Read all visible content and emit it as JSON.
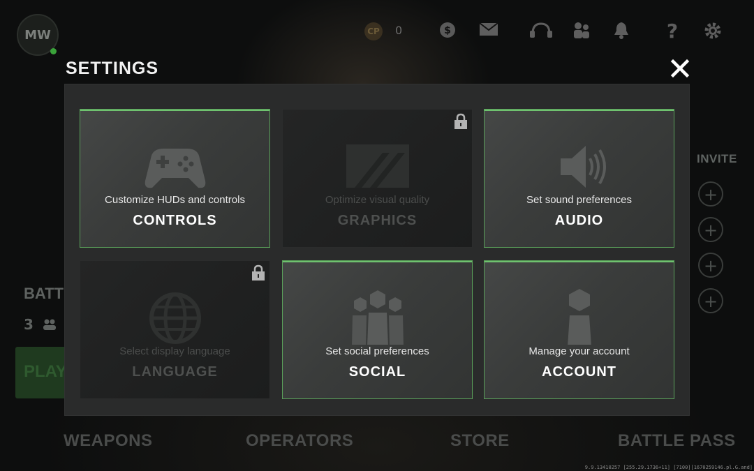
{
  "modal": {
    "title": "SETTINGS",
    "close_icon": "close-icon",
    "cards": [
      {
        "key": "controls",
        "subtitle": "Customize HUDs and controls",
        "label": "CONTROLS",
        "icon": "gamepad-icon",
        "locked": false
      },
      {
        "key": "graphics",
        "subtitle": "Optimize visual quality",
        "label": "GRAPHICS",
        "icon": "graphics-icon",
        "locked": true
      },
      {
        "key": "audio",
        "subtitle": "Set sound preferences",
        "label": "AUDIO",
        "icon": "speaker-icon",
        "locked": false
      },
      {
        "key": "language",
        "subtitle": "Select display language",
        "label": "LANGUAGE",
        "icon": "globe-icon",
        "locked": true
      },
      {
        "key": "social",
        "subtitle": "Set social preferences",
        "label": "SOCIAL",
        "icon": "people-icon",
        "locked": false
      },
      {
        "key": "account",
        "subtitle": "Manage your account",
        "label": "ACCOUNT",
        "icon": "person-icon",
        "locked": false
      }
    ]
  },
  "background": {
    "cp_label": "CP",
    "cp_value": "0",
    "invite_label": "INVITE",
    "battle_label": "BATTL",
    "battle_count": "3",
    "play_label": "PLAY",
    "bottom_nav": [
      "WEAPONS",
      "OPERATORS",
      "STORE",
      "BATTLE PASS"
    ],
    "version_text": "9.9.13410257 [255.29.1736+11] [7100][1670259146.pl.G.and]"
  },
  "colors": {
    "accent_green": "#6fc26f",
    "panel": "#2a2b2b",
    "card": "#3e403f"
  }
}
